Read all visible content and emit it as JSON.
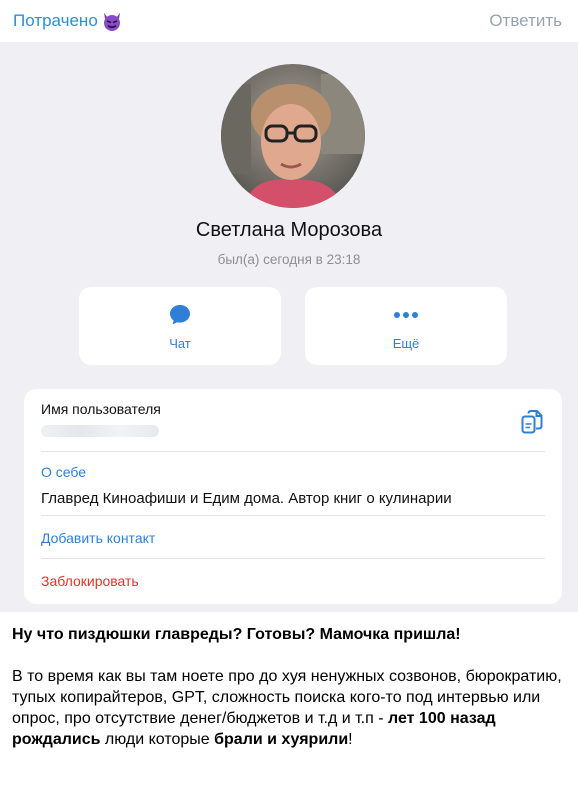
{
  "header": {
    "channel_name": "Потрачено",
    "reply_label": "Ответить"
  },
  "profile": {
    "name": "Светлана Морозова",
    "last_seen": "был(а) сегодня в 23:18",
    "actions": {
      "chat_label": "Чат",
      "more_label": "Ещё"
    },
    "info": {
      "username_label": "Имя пользователя",
      "about_label": "О себе",
      "about_text": "Главред Киноафиши и Едим дома. Автор книг о кулинарии",
      "add_contact_label": "Добавить контакт",
      "block_label": "Заблокировать"
    }
  },
  "message": {
    "headline": "Ну что пиздюшки главреды? Готовы? Мамочка пришла!",
    "body_part1": "В то время как вы там ноете про до хуя ненужных созвонов, бюрократию, тупых  копирайтеров, GPT, сложность поиска кого-то под интервью или опрос, про отсутствие денег/бюджетов и т.д и т.п - ",
    "body_bold1": "лет 100 назад рождались",
    "body_part2": " люди которые ",
    "body_bold2": "брали и хуярили",
    "body_part3": "!"
  },
  "colors": {
    "accent": "#2f7fd6",
    "danger": "#e0342c",
    "muted": "#8e8e93",
    "profile_bg": "#efeff4"
  },
  "icons": [
    "devil-emoji-icon",
    "chat-bubble-icon",
    "more-dots-icon",
    "copy-icon"
  ]
}
